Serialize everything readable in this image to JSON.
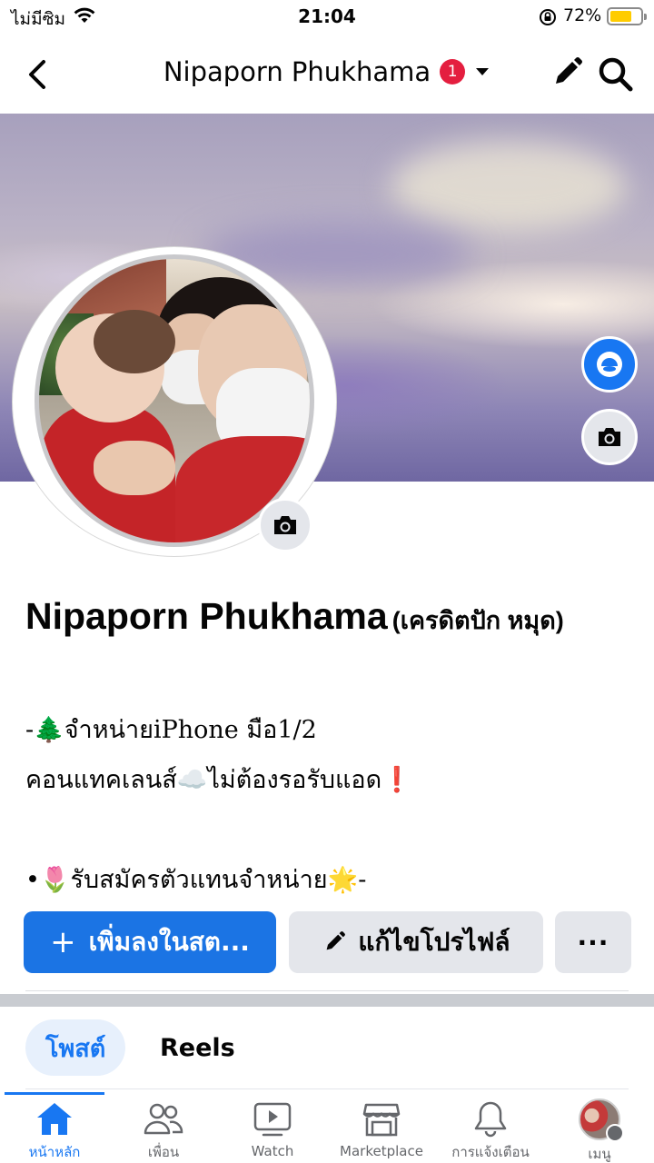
{
  "status_bar": {
    "carrier": "ไม่มีซิม",
    "time": "21:04",
    "battery_percent": "72%",
    "battery_level": 0.72
  },
  "header": {
    "title": "Nipaporn Phukhama",
    "notification_count": "1"
  },
  "profile": {
    "name": "Nipaporn Phukhama",
    "alternate_name": "(เครดิตปัก หมุด)",
    "bio_lines": [
      "-🌲จำหน่ายiPhone มือ1/2",
      "คอนแทคเลนส์☁️ไม่ต้องรอรับแอด❗",
      "",
      "•🌷รับสมัครตัวแทนจำหน่าย🌟-"
    ]
  },
  "actions": {
    "primary_label": "เพิ่มลงในสต...",
    "primary_icon": "+",
    "edit_label": "แก้ไขโปรไฟล์",
    "more_label": "···"
  },
  "tabs": [
    {
      "label": "โพสต์",
      "active": true
    },
    {
      "label": "Reels",
      "active": false
    }
  ],
  "bottom_nav": [
    {
      "label": "หน้าหลัก",
      "icon": "home-icon",
      "active": true
    },
    {
      "label": "เพื่อน",
      "icon": "friends-icon",
      "active": false
    },
    {
      "label": "Watch",
      "icon": "watch-icon",
      "active": false
    },
    {
      "label": "Marketplace",
      "icon": "marketplace-icon",
      "active": false
    },
    {
      "label": "การแจ้งเตือน",
      "icon": "bell-icon",
      "active": false
    },
    {
      "label": "เมนู",
      "icon": "menu-avatar-icon",
      "active": false
    }
  ],
  "colors": {
    "accent": "#1877f2",
    "primary_button": "#1b74e4",
    "badge": "#e41e3f",
    "battery": "#ffcc00"
  }
}
